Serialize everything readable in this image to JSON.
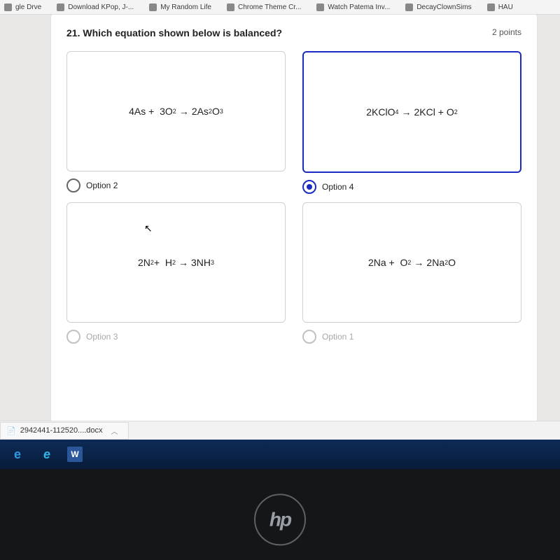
{
  "bookmarks": [
    {
      "label": "gle Drve"
    },
    {
      "label": "Download KPop, J-..."
    },
    {
      "label": "My Random Life"
    },
    {
      "label": "Chrome Theme Cr..."
    },
    {
      "label": "Watch Patema Inv..."
    },
    {
      "label": "DecayClownSims"
    },
    {
      "label": "HAU"
    }
  ],
  "question": {
    "title": "21. Which equation shown below is balanced?",
    "points": "2 points"
  },
  "options": [
    {
      "equation_html": "4As + &nbsp;3O<sub>2</sub> <span class='arrow'>→</span> 2As<sub>2</sub>O<sub>3</sub>",
      "label": "Option 2",
      "selected": false
    },
    {
      "equation_html": "2KClO<sub>4</sub> <span class='arrow'>→</span> 2KCl + O<sub>2</sub>",
      "label": "Option 4",
      "selected": true
    },
    {
      "equation_html": "2N<sub>2</sub> + &nbsp;H<sub>2</sub> <span class='arrow'>→</span> 3NH<sub>3</sub>",
      "label": "Option 3",
      "selected": false
    },
    {
      "equation_html": "2Na + &nbsp;O<sub>2</sub> <span class='arrow'>→</span> 2Na<sub>2</sub>O",
      "label": "Option 1",
      "selected": false
    }
  ],
  "download": {
    "filename": "2942441-112520....docx"
  },
  "logo": "hp"
}
